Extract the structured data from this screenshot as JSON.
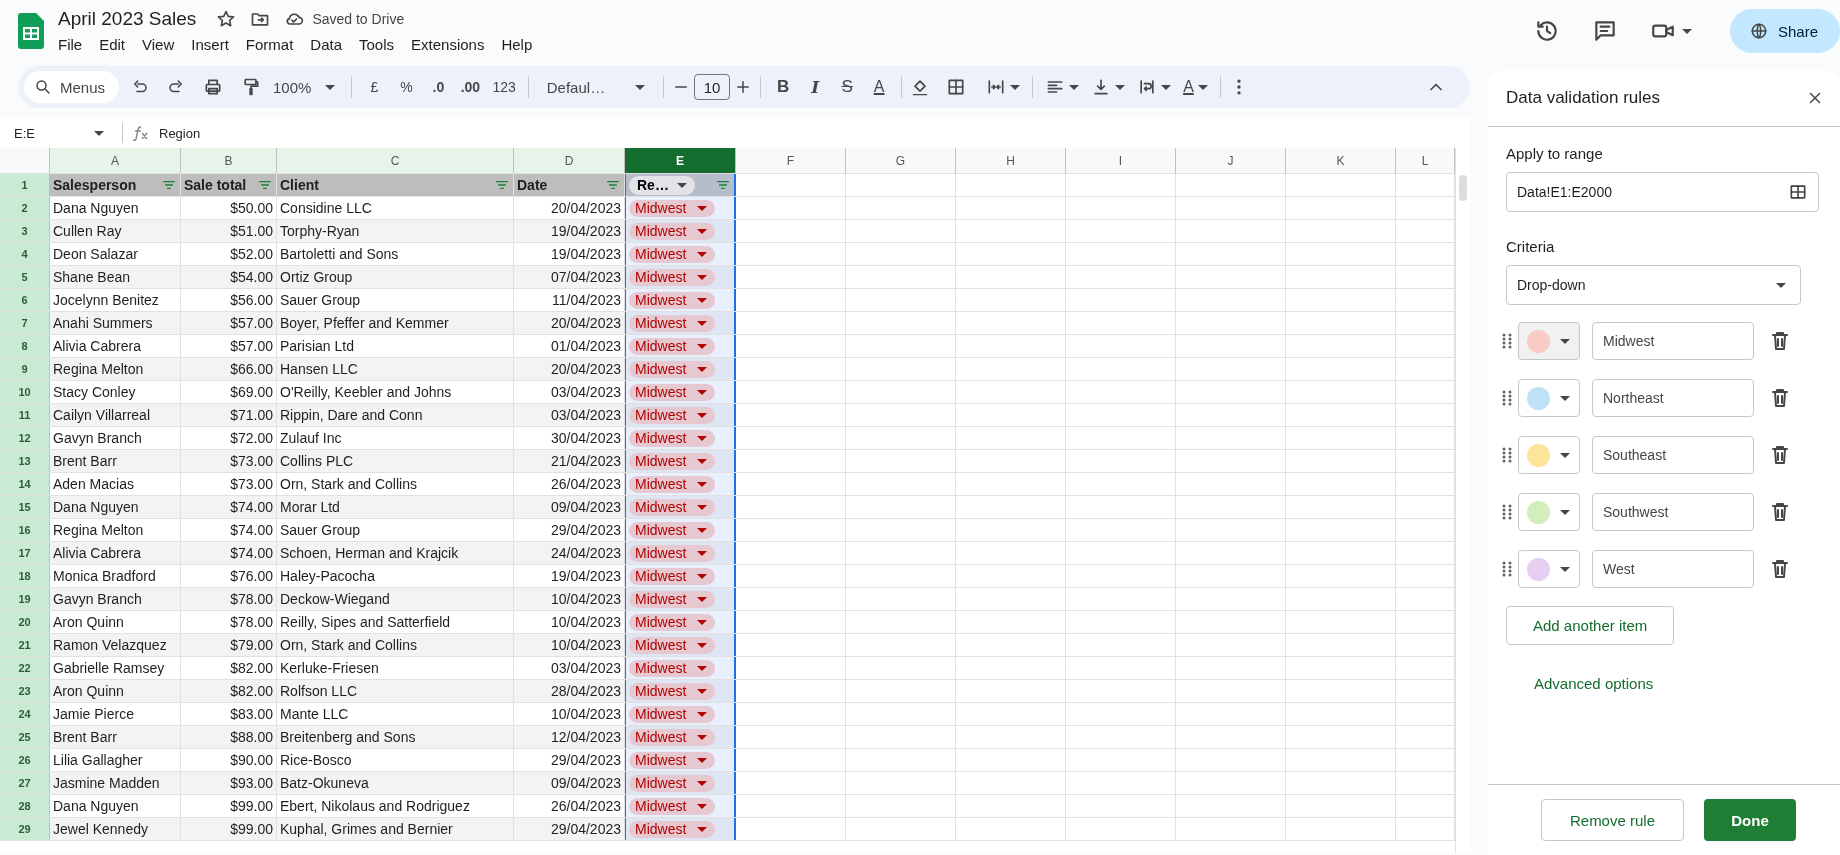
{
  "document": {
    "title": "April 2023 Sales",
    "save_status": "Saved to Drive"
  },
  "menu": [
    "File",
    "Edit",
    "View",
    "Insert",
    "Format",
    "Data",
    "Tools",
    "Extensions",
    "Help"
  ],
  "share_button": "Share",
  "toolbar": {
    "search_placeholder": "Menus",
    "zoom": "100%",
    "currency": "£",
    "percent": "%",
    "decrease_decimals": ".0",
    "increase_decimals": ".00",
    "number_format": "123",
    "font": "Defaul…",
    "font_size": "10",
    "bold": "B",
    "italic": "I",
    "strikethrough": "S",
    "text_color": "A",
    "text_rotation": "A"
  },
  "formula_bar": {
    "cell_ref": "E:E",
    "content": "Region"
  },
  "sheet": {
    "columns": [
      {
        "label": "A",
        "selected": false,
        "kind": "text"
      },
      {
        "label": "B",
        "selected": false,
        "kind": "number"
      },
      {
        "label": "C",
        "selected": false,
        "kind": "text"
      },
      {
        "label": "D",
        "selected": false,
        "kind": "number"
      },
      {
        "label": "E",
        "selected": true,
        "kind": "chip"
      },
      {
        "label": "F",
        "selected": false,
        "kind": "empty"
      },
      {
        "label": "G",
        "selected": false,
        "kind": "empty"
      },
      {
        "label": "H",
        "selected": false,
        "kind": "empty"
      },
      {
        "label": "I",
        "selected": false,
        "kind": "empty"
      },
      {
        "label": "J",
        "selected": false,
        "kind": "empty"
      },
      {
        "label": "K",
        "selected": false,
        "kind": "empty"
      },
      {
        "label": "L",
        "selected": false,
        "kind": "empty"
      }
    ],
    "header": {
      "number": "1",
      "cells": [
        "Salesperson",
        "Sale total",
        "Client",
        "Date",
        "Re…"
      ]
    },
    "rows": [
      {
        "number": "2",
        "cells": [
          "Dana Nguyen",
          "$50.00",
          "Considine LLC",
          "20/04/2023",
          "Midwest"
        ]
      },
      {
        "number": "3",
        "cells": [
          "Cullen Ray",
          "$51.00",
          "Torphy-Ryan",
          "19/04/2023",
          "Midwest"
        ]
      },
      {
        "number": "4",
        "cells": [
          "Deon Salazar",
          "$52.00",
          "Bartoletti and Sons",
          "19/04/2023",
          "Midwest"
        ]
      },
      {
        "number": "5",
        "cells": [
          "Shane Bean",
          "$54.00",
          "Ortiz Group",
          "07/04/2023",
          "Midwest"
        ]
      },
      {
        "number": "6",
        "cells": [
          "Jocelynn Benitez",
          "$56.00",
          "Sauer Group",
          "11/04/2023",
          "Midwest"
        ]
      },
      {
        "number": "7",
        "cells": [
          "Anahi Summers",
          "$57.00",
          "Boyer, Pfeffer and Kemmer",
          "20/04/2023",
          "Midwest"
        ]
      },
      {
        "number": "8",
        "cells": [
          "Alivia Cabrera",
          "$57.00",
          "Parisian Ltd",
          "01/04/2023",
          "Midwest"
        ]
      },
      {
        "number": "9",
        "cells": [
          "Regina Melton",
          "$66.00",
          "Hansen LLC",
          "20/04/2023",
          "Midwest"
        ]
      },
      {
        "number": "10",
        "cells": [
          "Stacy Conley",
          "$69.00",
          "O'Reilly, Keebler and Johns",
          "03/04/2023",
          "Midwest"
        ]
      },
      {
        "number": "11",
        "cells": [
          "Cailyn Villarreal",
          "$71.00",
          "Rippin, Dare and Conn",
          "03/04/2023",
          "Midwest"
        ]
      },
      {
        "number": "12",
        "cells": [
          "Gavyn Branch",
          "$72.00",
          "Zulauf Inc",
          "30/04/2023",
          "Midwest"
        ]
      },
      {
        "number": "13",
        "cells": [
          "Brent Barr",
          "$73.00",
          "Collins PLC",
          "21/04/2023",
          "Midwest"
        ]
      },
      {
        "number": "14",
        "cells": [
          "Aden Macias",
          "$73.00",
          "Orn, Stark and Collins",
          "26/04/2023",
          "Midwest"
        ]
      },
      {
        "number": "15",
        "cells": [
          "Dana Nguyen",
          "$74.00",
          "Morar Ltd",
          "09/04/2023",
          "Midwest"
        ]
      },
      {
        "number": "16",
        "cells": [
          "Regina Melton",
          "$74.00",
          "Sauer Group",
          "29/04/2023",
          "Midwest"
        ]
      },
      {
        "number": "17",
        "cells": [
          "Alivia Cabrera",
          "$74.00",
          "Schoen, Herman and Krajcik",
          "24/04/2023",
          "Midwest"
        ]
      },
      {
        "number": "18",
        "cells": [
          "Monica Bradford",
          "$76.00",
          "Haley-Pacocha",
          "19/04/2023",
          "Midwest"
        ]
      },
      {
        "number": "19",
        "cells": [
          "Gavyn Branch",
          "$78.00",
          "Deckow-Wiegand",
          "10/04/2023",
          "Midwest"
        ]
      },
      {
        "number": "20",
        "cells": [
          "Aron Quinn",
          "$78.00",
          "Reilly, Sipes and Satterfield",
          "10/04/2023",
          "Midwest"
        ]
      },
      {
        "number": "21",
        "cells": [
          "Ramon Velazquez",
          "$79.00",
          "Orn, Stark and Collins",
          "10/04/2023",
          "Midwest"
        ]
      },
      {
        "number": "22",
        "cells": [
          "Gabrielle Ramsey",
          "$82.00",
          "Kerluke-Friesen",
          "03/04/2023",
          "Midwest"
        ]
      },
      {
        "number": "23",
        "cells": [
          "Aron Quinn",
          "$82.00",
          "Rolfson LLC",
          "28/04/2023",
          "Midwest"
        ]
      },
      {
        "number": "24",
        "cells": [
          "Jamie Pierce",
          "$83.00",
          "Mante LLC",
          "10/04/2023",
          "Midwest"
        ]
      },
      {
        "number": "25",
        "cells": [
          "Brent Barr",
          "$88.00",
          "Breitenberg and Sons",
          "12/04/2023",
          "Midwest"
        ]
      },
      {
        "number": "26",
        "cells": [
          "Lilia Gallagher",
          "$90.00",
          "Rice-Bosco",
          "29/04/2023",
          "Midwest"
        ]
      },
      {
        "number": "27",
        "cells": [
          "Jasmine Madden",
          "$93.00",
          "Batz-Okuneva",
          "09/04/2023",
          "Midwest"
        ]
      },
      {
        "number": "28",
        "cells": [
          "Dana Nguyen",
          "$99.00",
          "Ebert, Nikolaus and Rodriguez",
          "26/04/2023",
          "Midwest"
        ]
      },
      {
        "number": "29",
        "cells": [
          "Jewel Kennedy",
          "$99.00",
          "Kuphal, Grimes and Bernier",
          "29/04/2023",
          "Midwest"
        ]
      }
    ]
  },
  "panel": {
    "title": "Data validation rules",
    "range_label": "Apply to range",
    "range_value": "Data!E1:E2000",
    "criteria_label": "Criteria",
    "criteria_value": "Drop-down",
    "items": [
      {
        "value": "Midwest",
        "color": "#f9cbc5",
        "focused": true
      },
      {
        "value": "Northeast",
        "color": "#bfe1f6",
        "focused": false
      },
      {
        "value": "Southeast",
        "color": "#fee39b",
        "focused": false
      },
      {
        "value": "Southwest",
        "color": "#d4edbc",
        "focused": false
      },
      {
        "value": "West",
        "color": "#e6cff2",
        "focused": false
      }
    ],
    "add_button": "Add another item",
    "advanced_link": "Advanced options",
    "remove_button": "Remove rule",
    "done_button": "Done"
  }
}
